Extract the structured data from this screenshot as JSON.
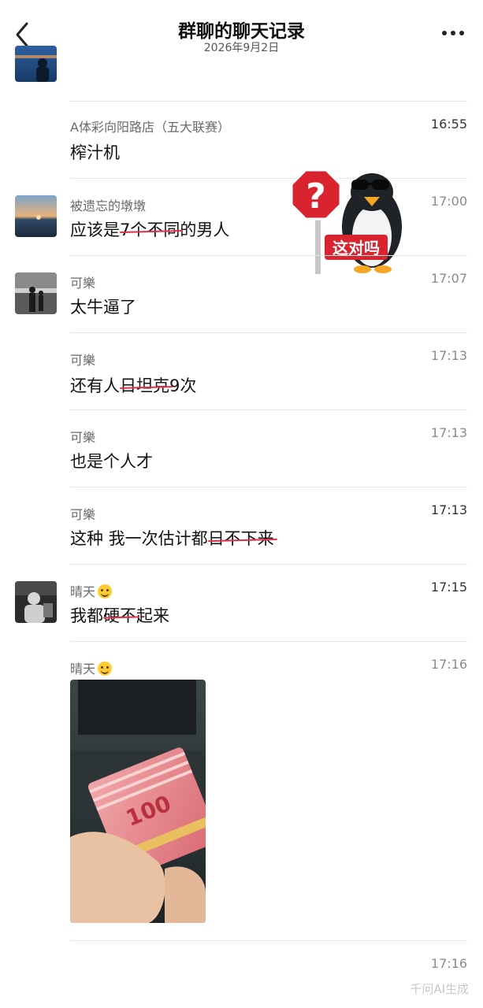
{
  "header": {
    "title": "群聊的聊天记录",
    "date": "2026年9月2日"
  },
  "messages": [
    {
      "sender": "A体彩向阳路店（五大联赛）",
      "time": "16:55",
      "text": "榨汁机"
    },
    {
      "sender": "被遗忘的墩墩",
      "time": "17:00",
      "text_before": "应该是",
      "text_struck": "7个不同",
      "text_after": "的男人"
    },
    {
      "sender": "可樂",
      "time": "17:07",
      "text": "太牛逼了"
    },
    {
      "sender": "可樂",
      "time": "17:13",
      "text_before": "还有人",
      "text_struck": "日坦克",
      "text_after": "9次"
    },
    {
      "sender": "可樂",
      "time": "17:13",
      "text": "也是个人才"
    },
    {
      "sender": "可樂",
      "time": "17:13",
      "text_before": "这种 我一次估计都",
      "text_struck": "日不下来",
      "text_after": ""
    },
    {
      "sender": "晴天",
      "time": "17:15",
      "text_before": "我都",
      "text_struck": "硬不",
      "text_after": "起来"
    },
    {
      "sender": "晴天",
      "time": "17:16"
    },
    {
      "time": "17:16"
    }
  ],
  "sticker": {
    "sign_text": "这对吗"
  },
  "watermark": "千问AI生成"
}
